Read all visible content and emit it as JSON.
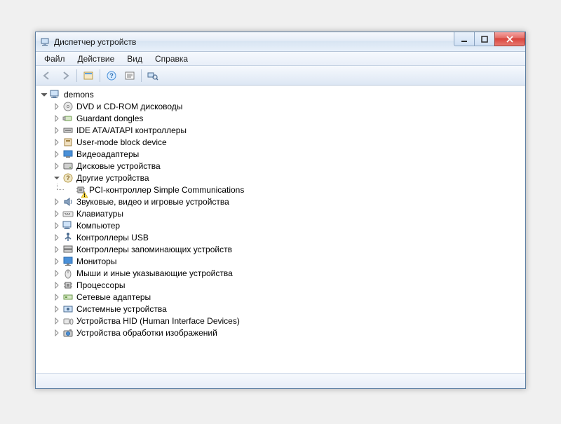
{
  "window": {
    "title": "Диспетчер устройств"
  },
  "menu": {
    "file": "Файл",
    "action": "Действие",
    "view": "Вид",
    "help": "Справка"
  },
  "tree": {
    "root": "demons",
    "categories": [
      {
        "label": "DVD и CD-ROM дисководы"
      },
      {
        "label": "Guardant dongles"
      },
      {
        "label": "IDE ATA/ATAPI контроллеры"
      },
      {
        "label": "User-mode block device"
      },
      {
        "label": "Видеоадаптеры"
      },
      {
        "label": "Дисковые устройства"
      },
      {
        "label": "Другие устройства",
        "expanded": true,
        "children": [
          {
            "label": "PCI-контроллер Simple Communications",
            "warning": true
          }
        ]
      },
      {
        "label": "Звуковые, видео и игровые устройства"
      },
      {
        "label": "Клавиатуры"
      },
      {
        "label": "Компьютер"
      },
      {
        "label": "Контроллеры USB"
      },
      {
        "label": "Контроллеры запоминающих устройств"
      },
      {
        "label": "Мониторы"
      },
      {
        "label": "Мыши и иные указывающие устройства"
      },
      {
        "label": "Процессоры"
      },
      {
        "label": "Сетевые адаптеры"
      },
      {
        "label": "Системные устройства"
      },
      {
        "label": "Устройства HID (Human Interface Devices)"
      },
      {
        "label": "Устройства обработки изображений"
      }
    ]
  },
  "icons": {
    "dvd": "dvd",
    "dongle": "dongle",
    "ide": "ide",
    "block": "block",
    "display": "display",
    "disk": "disk",
    "other": "other",
    "sound": "sound",
    "keyboard": "keyboard",
    "computer": "computer",
    "usb": "usb",
    "storage": "storage",
    "monitor": "monitor",
    "mouse": "mouse",
    "cpu": "cpu",
    "network": "network",
    "system": "system",
    "hid": "hid",
    "imaging": "imaging"
  }
}
